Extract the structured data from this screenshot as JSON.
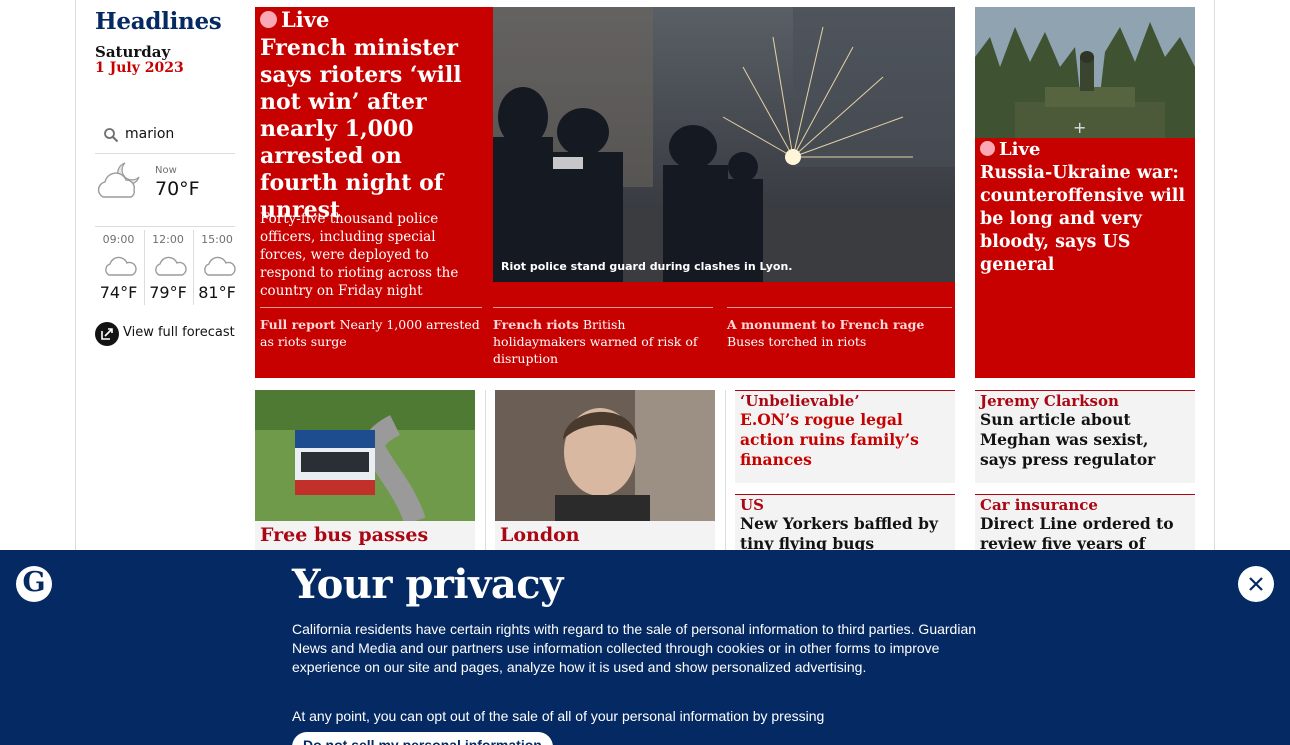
{
  "sidebar": {
    "title": "Headlines",
    "day": "Saturday",
    "date": "1 July 2023",
    "search_value": "marion",
    "weather": {
      "now_label": "Now",
      "now_temp": "70°F",
      "now_icon": "partly-cloudy-night-icon",
      "forecast": [
        {
          "time": "09:00",
          "temp": "74°F",
          "icon": "cloud-icon"
        },
        {
          "time": "12:00",
          "temp": "79°F",
          "icon": "cloud-icon"
        },
        {
          "time": "15:00",
          "temp": "81°F",
          "icon": "cloud-icon"
        }
      ],
      "full_forecast_label": "View full forecast"
    }
  },
  "feature": {
    "live_label": "Live",
    "headline": "French minister says rioters ‘will not win’ after nearly 1,000 arrested on fourth night of unrest",
    "standfirst": "Forty-five thousand police officers, including special forces, were deployed to respond to rioting across the country on Friday night",
    "image_caption": "Riot police stand guard during clashes in Lyon.",
    "sublinks": [
      {
        "kicker": "Full report",
        "text": "Nearly 1,000 arrested as riots surge"
      },
      {
        "kicker": "French riots",
        "text": "British holidaymakers warned of risk of disruption"
      },
      {
        "kicker": "A monument to French rage",
        "text": "Buses torched in riots"
      }
    ]
  },
  "side_feature": {
    "live_label": "Live",
    "headline": "Russia-Ukraine war: counteroffensive will be long and very bloody, says US general"
  },
  "cards": [
    {
      "kicker": "Free bus passes"
    },
    {
      "kicker": "London"
    }
  ],
  "small_cards": [
    {
      "kicker": "‘Unbelievable’",
      "title": "E.ON’s rogue legal action ruins family’s finances"
    },
    {
      "kicker": "Jeremy Clarkson",
      "title": "Sun article about Meghan was sexist, says press regulator"
    },
    {
      "kicker": "US",
      "title": "New Yorkers baffled by tiny flying bugs swarming city"
    },
    {
      "kicker": "Car insurance",
      "title": "Direct Line ordered to review five years of claims"
    }
  ],
  "privacy": {
    "title": "Your privacy",
    "body": "California residents have certain rights with regard to the sale of personal information to third parties. Guardian News and Media and our partners use information collected through cookies or in other forms to improve experience on our site and pages, analyze how it is used and show personalized advertising.",
    "body2": "At any point, you can opt out of the sale of all of your personal information by pressing",
    "button_label": "Do not sell my personal information"
  },
  "colors": {
    "news_red": "#c70000",
    "kicker_red": "#ab0613",
    "brand_blue": "#052962"
  }
}
